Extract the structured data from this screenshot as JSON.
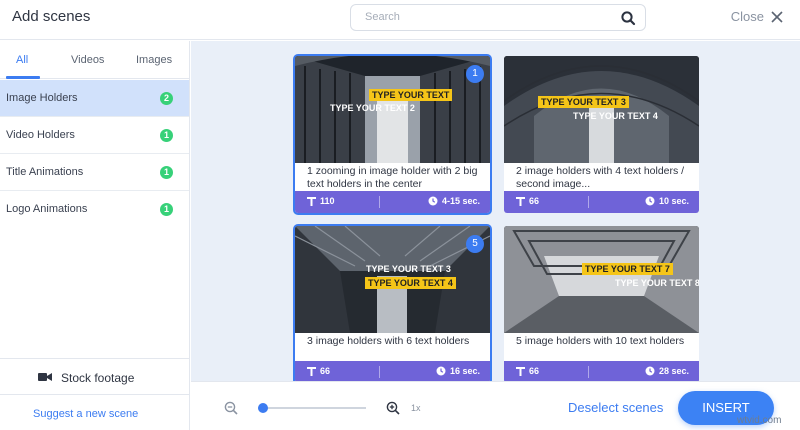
{
  "header": {
    "title": "Add scenes",
    "search_placeholder": "Search",
    "close_label": "Close"
  },
  "sidebar": {
    "tabs": [
      {
        "label": "All",
        "active": true
      },
      {
        "label": "Videos",
        "active": false
      },
      {
        "label": "Images",
        "active": false
      }
    ],
    "categories": [
      {
        "label": "Image Holders",
        "count": "2",
        "active": true
      },
      {
        "label": "Video Holders",
        "count": "1",
        "active": false
      },
      {
        "label": "Title Animations",
        "count": "1",
        "active": false
      },
      {
        "label": "Logo Animations",
        "count": "1",
        "active": false
      }
    ],
    "stock_footage_label": "Stock footage",
    "suggest_label": "Suggest a new scene"
  },
  "cards": [
    {
      "tags": [
        "TYPE YOUR TEXT",
        "TYPE YOUR TEXT 2"
      ],
      "selected_number": "1",
      "description": "1 zooming in image holder with 2 big text holders in the center",
      "chars": "110",
      "duration": "4-15 sec."
    },
    {
      "tags": [
        "TYPE YOUR TEXT 3",
        "TYPE YOUR TEXT 4"
      ],
      "selected_number": "",
      "description": "2 image holders with 4 text holders / second image...",
      "chars": "66",
      "duration": "10 sec."
    },
    {
      "tags": [
        "TYPE YOUR TEXT 3",
        "TYPE YOUR TEXT 4"
      ],
      "selected_number": "5",
      "description": "3 image holders with 6 text holders",
      "chars": "66",
      "duration": "16 sec."
    },
    {
      "tags": [
        "TYPE YOUR TEXT 7",
        "TYPE YOUR TEXT 8"
      ],
      "selected_number": "",
      "description": "5 image holders with 10 text holders",
      "chars": "66",
      "duration": "28 sec."
    }
  ],
  "footer": {
    "zoom_level": "1x",
    "zoom_slider_fraction": 0,
    "deselect_label": "Deselect scenes",
    "insert_label": "INSERT",
    "watermark": "wtvid.com"
  },
  "colors": {
    "accent": "#3c7cf1",
    "badge_green": "#37d179",
    "card_footer": "#6f63d8",
    "tag_yellow": "#f5c518"
  },
  "icons": [
    "search-icon",
    "close-icon",
    "camera-icon",
    "zoom-out-icon",
    "zoom-in-icon",
    "text-icon",
    "clock-icon"
  ]
}
